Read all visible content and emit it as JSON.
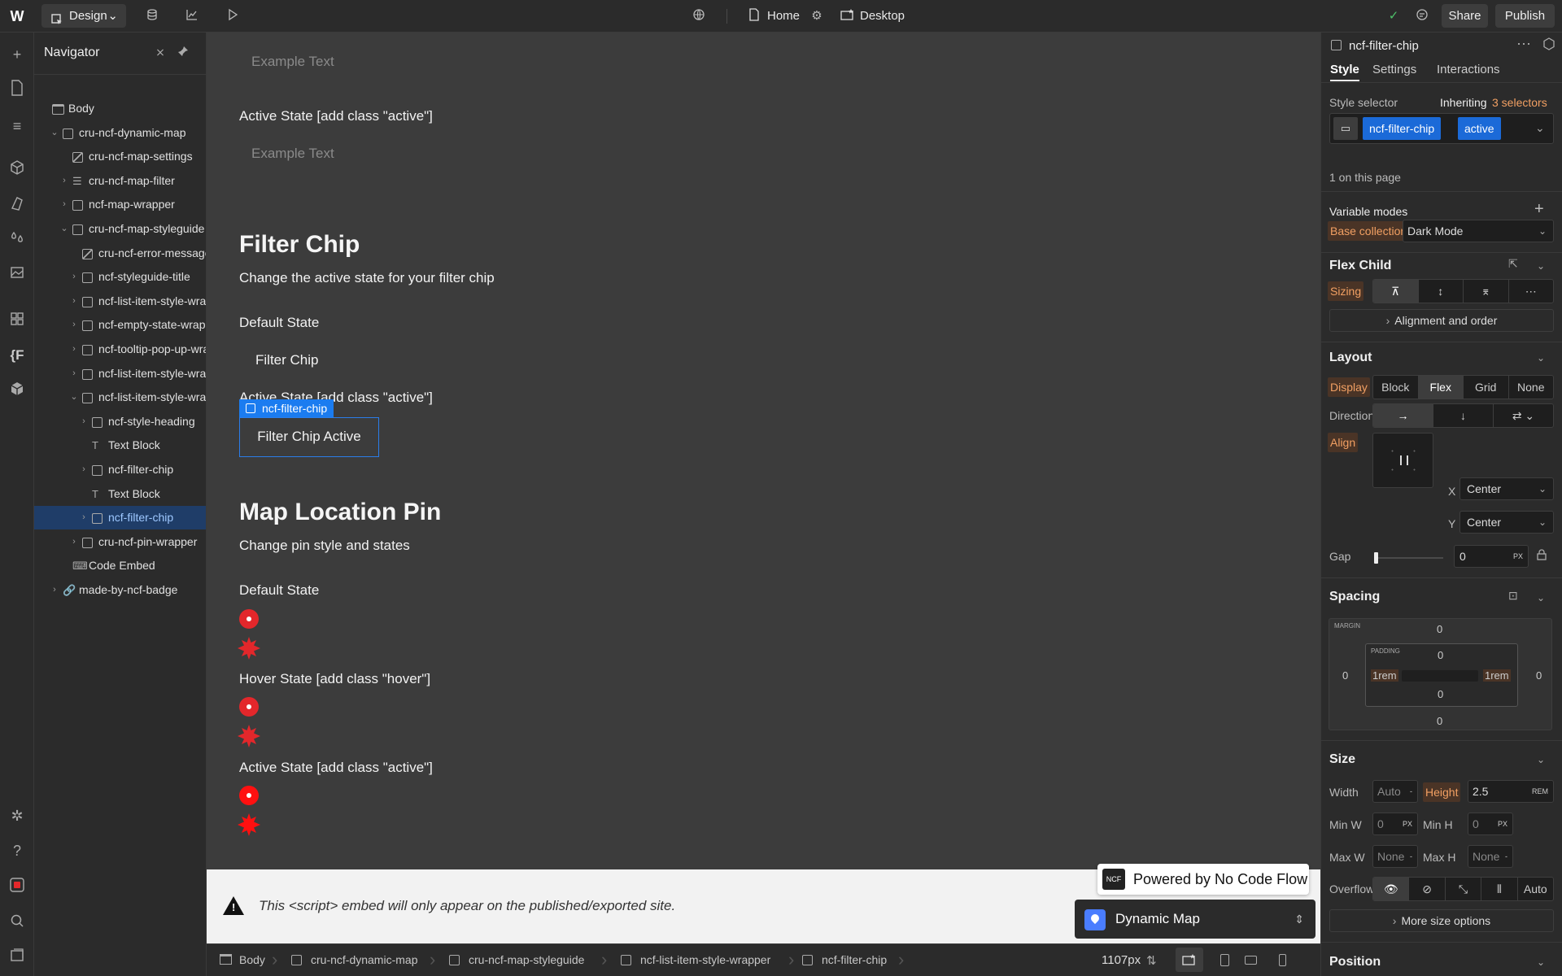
{
  "topbar": {
    "mode_label": "Design",
    "page_label": "Home",
    "breakpoint_label": "Desktop",
    "share_label": "Share",
    "publish_label": "Publish"
  },
  "navigator": {
    "title": "Navigator",
    "items": [
      {
        "label": "Body"
      },
      {
        "label": "cru-ncf-dynamic-map"
      },
      {
        "label": "cru-ncf-map-settings"
      },
      {
        "label": "cru-ncf-map-filter"
      },
      {
        "label": "ncf-map-wrapper"
      },
      {
        "label": "cru-ncf-map-styleguide"
      },
      {
        "label": "cru-ncf-error-message"
      },
      {
        "label": "ncf-styleguide-title"
      },
      {
        "label": "ncf-list-item-style-wrapper"
      },
      {
        "label": "ncf-empty-state-wrapper"
      },
      {
        "label": "ncf-tooltip-pop-up-wrapper"
      },
      {
        "label": "ncf-list-item-style-wrapper"
      },
      {
        "label": "ncf-list-item-style-wrapper"
      },
      {
        "label": "ncf-style-heading"
      },
      {
        "label": "Text Block"
      },
      {
        "label": "ncf-filter-chip"
      },
      {
        "label": "Text Block"
      },
      {
        "label": "ncf-filter-chip"
      },
      {
        "label": "cru-ncf-pin-wrapper"
      },
      {
        "label": "Code Embed"
      },
      {
        "label": "made-by-ncf-badge"
      }
    ]
  },
  "canvas": {
    "example_text_1": "Example Text",
    "active_state_1": "Active State [add class \"active\"]",
    "example_text_2": "Example Text",
    "filter_chip_heading": "Filter Chip",
    "filter_chip_sub": "Change the active state for your filter chip",
    "default_state_1": "Default State",
    "filter_chip_label": "Filter Chip",
    "active_state_2": "Active State [add class \"active\"]",
    "selected_tag": "ncf-filter-chip",
    "filter_chip_active_label": "Filter Chip Active",
    "map_pin_heading": "Map Location Pin",
    "map_pin_sub": "Change pin style and states",
    "default_state_2": "Default State",
    "hover_state": "Hover State [add class \"hover\"]",
    "active_state_3": "Active State [add class \"active\"]"
  },
  "embed_bar": {
    "warning_text": "This <script> embed will only appear on the published/exported site.",
    "powered_label": "Powered by No Code Flow",
    "powered_logo": "NCF",
    "dynamic_map_label": "Dynamic Map"
  },
  "breadcrumb": {
    "items": [
      "Body",
      "cru-ncf-dynamic-map",
      "cru-ncf-map-styleguide",
      "ncf-list-item-style-wrapper",
      "ncf-filter-chip"
    ],
    "width_readout": "1107px"
  },
  "panel": {
    "element_name": "ncf-filter-chip",
    "tabs": [
      "Style",
      "Settings",
      "Interactions"
    ],
    "style_selector_label": "Style selector",
    "inheriting_label": "Inheriting",
    "inheriting_count": "3 selectors",
    "selector_tags": [
      "ncf-filter-chip",
      "active"
    ],
    "on_page": "1 on this page",
    "variable_modes_label": "Variable modes",
    "base_collection_label": "Base collection",
    "base_collection_value": "Dark Mode",
    "flex_child_label": "Flex Child",
    "sizing_label": "Sizing",
    "alignment_order_label": "Alignment and order",
    "layout_label": "Layout",
    "display_label": "Display",
    "display_options": [
      "Block",
      "Flex",
      "Grid",
      "None"
    ],
    "display_selected": "Flex",
    "direction_label": "Direction",
    "align_label": "Align",
    "align_x_label": "X",
    "align_x_value": "Center",
    "align_y_label": "Y",
    "align_y_value": "Center",
    "gap_label": "Gap",
    "gap_value": "0",
    "gap_unit": "PX",
    "spacing_label": "Spacing",
    "margin_label": "MARGIN",
    "padding_label": "PADDING",
    "margin_top": "0",
    "margin_left": "0",
    "margin_right": "0",
    "margin_bottom": "0",
    "padding_top": "0",
    "padding_left": "1rem",
    "padding_right": "1rem",
    "padding_bottom": "0",
    "size_label": "Size",
    "width_label": "Width",
    "width_value": "Auto",
    "height_label": "Height",
    "height_value": "2.5",
    "height_unit": "REM",
    "min_w_label": "Min W",
    "min_w_value": "0",
    "min_w_unit": "PX",
    "min_h_label": "Min H",
    "min_h_value": "0",
    "min_h_unit": "PX",
    "max_w_label": "Max W",
    "max_w_value": "None",
    "max_h_label": "Max H",
    "max_h_value": "None",
    "overflow_label": "Overflow",
    "overflow_auto": "Auto",
    "more_size_label": "More size options",
    "position_label": "Position"
  },
  "colors": {
    "accent": "#1b7cf0",
    "pin_red": "#e3272b",
    "orange_label": "#f2a063"
  }
}
